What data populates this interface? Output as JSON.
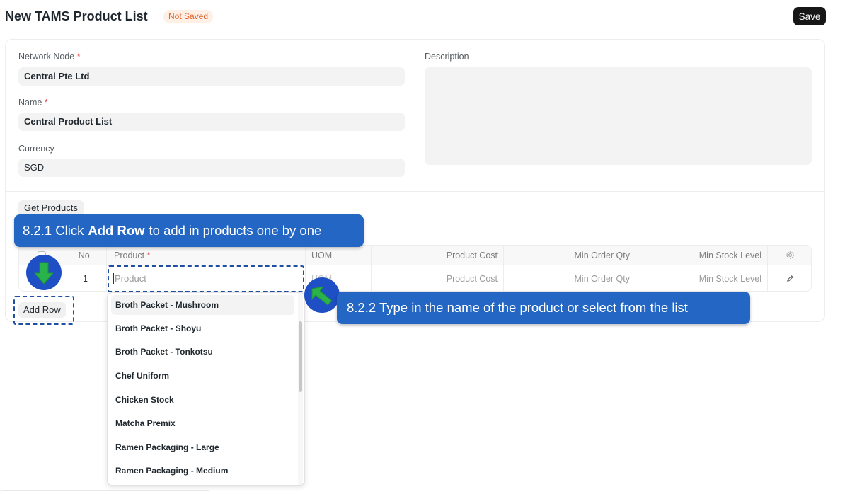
{
  "header": {
    "title": "New TAMS Product List",
    "status": "Not Saved",
    "save_label": "Save"
  },
  "form": {
    "network_node": {
      "label": "Network Node",
      "required": "*",
      "value": "Central Pte Ltd"
    },
    "name": {
      "label": "Name",
      "required": "*",
      "value": "Central Product List"
    },
    "currency": {
      "label": "Currency",
      "value": "SGD"
    },
    "description": {
      "label": "Description"
    }
  },
  "products": {
    "get_products_label": "Get Products",
    "add_row_label": "Add Row",
    "columns": {
      "no": "No.",
      "product": "Product",
      "product_required": "*",
      "uom": "UOM",
      "product_cost": "Product Cost",
      "min_order_qty": "Min Order Qty",
      "min_stock_level": "Min Stock Level"
    },
    "row": {
      "no": "1",
      "product_placeholder": "Product",
      "uom_placeholder": "UOM",
      "product_cost_placeholder": "Product Cost",
      "min_order_qty_placeholder": "Min Order Qty",
      "min_stock_level_placeholder": "Min Stock Level"
    },
    "dropdown": [
      "Broth Packet - Mushroom",
      "Broth Packet - Shoyu",
      "Broth Packet - Tonkotsu",
      "Chef Uniform",
      "Chicken Stock",
      "Matcha Premix",
      "Ramen Packaging - Large",
      "Ramen Packaging - Medium"
    ]
  },
  "annotations": {
    "step1_prefix": "8.2.1 Click",
    "step1_bold": "Add Row",
    "step1_suffix": "to add in products one by one",
    "step2": "8.2.2 Type in the name of the product or select from the list"
  },
  "colors": {
    "callout": "#2366c4",
    "arrow": "#2ab34a",
    "circle": "#1e4fc4",
    "save_button": "#171717",
    "status_text": "#e0622b"
  }
}
